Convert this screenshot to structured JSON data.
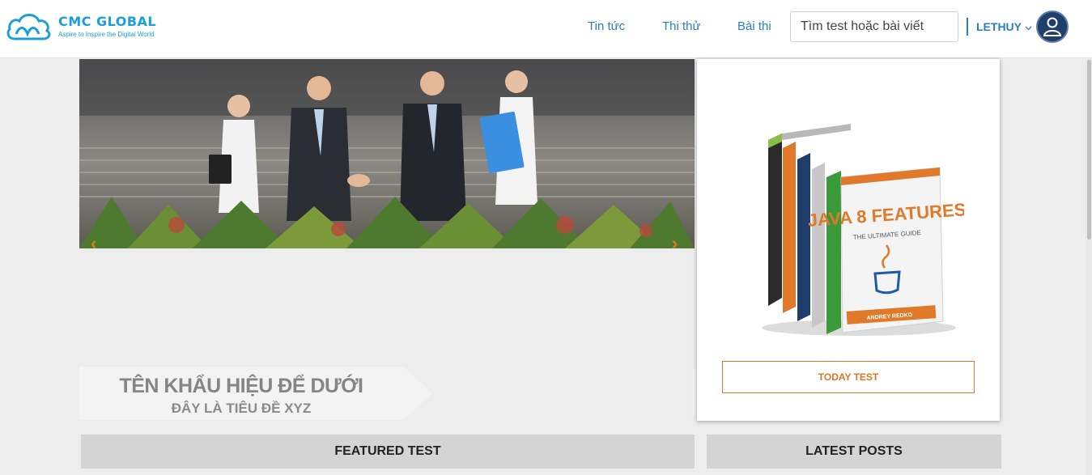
{
  "brand": {
    "name": "CMC GLOBAL",
    "slogan": "Aspire to Inspire the Digital World",
    "color": "#1b9fd6"
  },
  "nav": {
    "items": [
      {
        "label": "Tin tức"
      },
      {
        "label": "Thi thử"
      },
      {
        "label": "Bài thi"
      }
    ],
    "color": "#2a7fc2"
  },
  "search": {
    "placeholder": "Tìm test hoặc bài viết",
    "value": ""
  },
  "user": {
    "name": "LETHUY",
    "avatar_icon": "user-avatar-icon"
  },
  "banner": {
    "image": "business-handshake-photo",
    "prev_icon": "chevron-left-icon",
    "next_icon": "chevron-right-icon",
    "title": "TÊN KHẨU HIỆU ĐỂ DƯỚI",
    "subtitle": "ĐÂY LÀ TIÊU ĐỀ XYZ"
  },
  "today": {
    "image": "java-books-stack",
    "book_title": "JAVA 8 FEATURES",
    "book_subtitle": "THE ULTIMATE GUIDE",
    "book_author": "ANDREY REDKO",
    "button_label": "TODAY TEST",
    "accent": "#d7772a"
  },
  "sections": {
    "featured": "FEATURED TEST",
    "latest": "LATEST POSTS"
  }
}
